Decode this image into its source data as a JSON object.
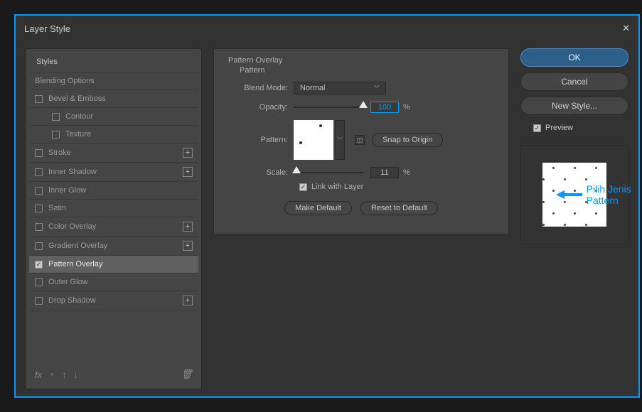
{
  "window": {
    "title": "Layer Style"
  },
  "styles_panel": {
    "header": "Styles",
    "items": [
      {
        "key": "blending",
        "label": "Blending Options",
        "checkable": false
      },
      {
        "key": "bevel",
        "label": "Bevel & Emboss",
        "checkable": true,
        "checked": false
      },
      {
        "key": "contour",
        "label": "Contour",
        "checkable": true,
        "checked": false,
        "indent": true
      },
      {
        "key": "texture",
        "label": "Texture",
        "checkable": true,
        "checked": false,
        "indent": true
      },
      {
        "key": "stroke",
        "label": "Stroke",
        "checkable": true,
        "checked": false,
        "plus": true
      },
      {
        "key": "innershadow",
        "label": "Inner Shadow",
        "checkable": true,
        "checked": false,
        "plus": true
      },
      {
        "key": "innerglow",
        "label": "Inner Glow",
        "checkable": true,
        "checked": false
      },
      {
        "key": "satin",
        "label": "Satin",
        "checkable": true,
        "checked": false
      },
      {
        "key": "coloroverlay",
        "label": "Color Overlay",
        "checkable": true,
        "checked": false,
        "plus": true
      },
      {
        "key": "gradientoverlay",
        "label": "Gradient Overlay",
        "checkable": true,
        "checked": false,
        "plus": true
      },
      {
        "key": "patternoverlay",
        "label": "Pattern Overlay",
        "checkable": true,
        "checked": true,
        "selected": true
      },
      {
        "key": "outerglow",
        "label": "Outer Glow",
        "checkable": true,
        "checked": false
      },
      {
        "key": "dropshadow",
        "label": "Drop Shadow",
        "checkable": true,
        "checked": false,
        "plus": true
      }
    ],
    "footer_fx": "fx"
  },
  "settings": {
    "header": "Pattern Overlay",
    "subheader": "Pattern",
    "blend_mode_label": "Blend Mode:",
    "blend_mode_value": "Normal",
    "opacity_label": "Opacity:",
    "opacity_value": "100",
    "opacity_unit": "%",
    "pattern_label": "Pattern:",
    "snap_label": "Snap to Origin",
    "scale_label": "Scale:",
    "scale_value": "11",
    "scale_unit": "%",
    "link_label": "Link with Layer",
    "make_default": "Make Default",
    "reset_default": "Reset to Default"
  },
  "annotation": {
    "text": "Pilih Jenis Pattern"
  },
  "right_panel": {
    "ok": "OK",
    "cancel": "Cancel",
    "new_style": "New Style...",
    "preview": "Preview"
  }
}
